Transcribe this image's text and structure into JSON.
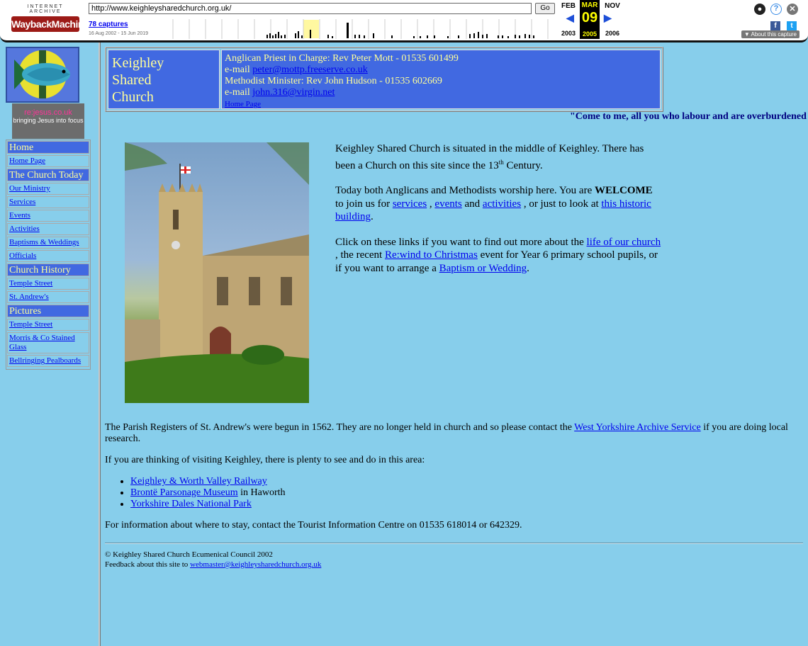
{
  "wayback": {
    "logo_top": "INTERNET ARCHIVE",
    "logo_main": "WaybackMachine",
    "url": "http://www.keighleysharedchurch.org.uk/",
    "go_label": "Go",
    "captures": "78 captures",
    "range": "16 Aug 2002 - 15 Jun 2019",
    "prev_month": "FEB",
    "cur_month": "MAR",
    "next_month": "NOV",
    "cur_day": "09",
    "prev_year": "2003",
    "cur_year": "2005",
    "next_year": "2006",
    "about": "About this capture"
  },
  "nav": {
    "logo_brand": "re:jesus.co.uk",
    "logo_tagline": "bringing Jesus into focus",
    "sections": [
      {
        "heading": "Home",
        "links": [
          "Home Page"
        ]
      },
      {
        "heading": "The Church Today",
        "links": [
          "Our Ministry",
          "Services",
          "Events",
          "Activities",
          "Baptisms & Weddings",
          "Officials"
        ]
      },
      {
        "heading": "Church History",
        "links": [
          "Temple Street",
          "St. Andrew's"
        ]
      },
      {
        "heading": "Pictures",
        "links": [
          "Temple Street",
          "Morris & Co Stained Glass",
          "Bellringing Pealboards"
        ]
      }
    ]
  },
  "header": {
    "title_lines": [
      "Keighley",
      "Shared",
      "Church"
    ],
    "priest": "Anglican Priest in Charge: Rev Peter Mott - 01535 601499",
    "email_label": "e-mail",
    "priest_email": "peter@mottp.freeserve.co.uk",
    "minister": "Methodist Minister: Rev John Hudson - 01535 602669",
    "minister_email": "john.316@virgin.net",
    "home_link": "Home Page"
  },
  "marquee": "\"Come to me, all you who labour and are overburdened",
  "intro": {
    "p1": "Keighley Shared Church is situated in the middle of Keighley. There has been a Church on this site since the 13",
    "p1_sup": "th",
    "p1_end": " Century.",
    "p2_a": "Today both Anglicans and Methodists worship here. You are ",
    "p2_welcome": "WELCOME",
    "p2_b": " to join us for ",
    "link_services": "services",
    "sep1": " , ",
    "link_events": "events",
    "and": " and ",
    "link_activities": "activities",
    "p2_c": " , or just to look at ",
    "link_building": "this historic building",
    "dot": ".",
    "p3_a": "Click on these links if you want to find out more about the ",
    "link_life": "life of our church",
    "p3_b": " , the recent ",
    "link_rewind": "Re:wind to Christmas",
    "p3_c": " event for Year 6 primary school pupils, or if you want to arrange a ",
    "link_baptism": "Baptism or Wedding"
  },
  "lower": {
    "registers_a": "The Parish Registers of St. Andrew's were begun in 1562. They are no longer held in church and so please contact the ",
    "registers_link": "West Yorkshire Archive Service",
    "registers_b": " if you are doing local research.",
    "visiting": "If you are thinking of visiting Keighley, there is plenty to see and do in this area:",
    "attractions": [
      {
        "link": "Keighley & Worth Valley Railway",
        "suffix": ""
      },
      {
        "link": "Brontë Parsonage Museum",
        "suffix": " in Haworth"
      },
      {
        "link": "Yorkshire Dales National Park",
        "suffix": ""
      }
    ],
    "tourist": "For information about where to stay, contact the Tourist Information Centre on 01535 618014 or 642329."
  },
  "footer": {
    "copyright": "© Keighley Shared Church Ecumenical Council 2002",
    "feedback": "Feedback about this site to ",
    "email": "webmaster@keighleysharedchurch.org.uk"
  }
}
